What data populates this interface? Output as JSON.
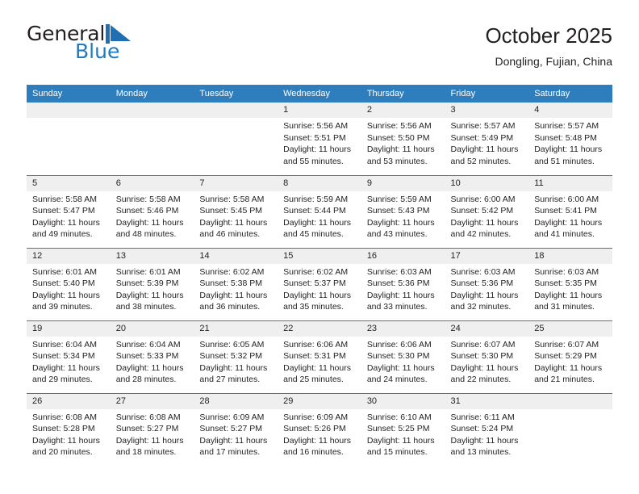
{
  "brand": {
    "name_part1": "General",
    "name_part2": "Blue",
    "mark_icon": "flag-triangle-icon",
    "accent_color": "#1f7bc1"
  },
  "header": {
    "month_title": "October 2025",
    "location": "Dongling, Fujian, China"
  },
  "colors": {
    "header_blue": "#2e7ebd",
    "daynum_band": "#efefef",
    "text": "#231f20"
  },
  "calendar": {
    "weekday_headers": [
      "Sunday",
      "Monday",
      "Tuesday",
      "Wednesday",
      "Thursday",
      "Friday",
      "Saturday"
    ],
    "weeks": [
      [
        {
          "day": "",
          "empty": true,
          "sunrise": "",
          "sunset": "",
          "daylight1": "",
          "daylight2": ""
        },
        {
          "day": "",
          "empty": true,
          "sunrise": "",
          "sunset": "",
          "daylight1": "",
          "daylight2": ""
        },
        {
          "day": "",
          "empty": true,
          "sunrise": "",
          "sunset": "",
          "daylight1": "",
          "daylight2": ""
        },
        {
          "day": "1",
          "empty": false,
          "sunrise": "Sunrise: 5:56 AM",
          "sunset": "Sunset: 5:51 PM",
          "daylight1": "Daylight: 11 hours",
          "daylight2": "and 55 minutes."
        },
        {
          "day": "2",
          "empty": false,
          "sunrise": "Sunrise: 5:56 AM",
          "sunset": "Sunset: 5:50 PM",
          "daylight1": "Daylight: 11 hours",
          "daylight2": "and 53 minutes."
        },
        {
          "day": "3",
          "empty": false,
          "sunrise": "Sunrise: 5:57 AM",
          "sunset": "Sunset: 5:49 PM",
          "daylight1": "Daylight: 11 hours",
          "daylight2": "and 52 minutes."
        },
        {
          "day": "4",
          "empty": false,
          "sunrise": "Sunrise: 5:57 AM",
          "sunset": "Sunset: 5:48 PM",
          "daylight1": "Daylight: 11 hours",
          "daylight2": "and 51 minutes."
        }
      ],
      [
        {
          "day": "5",
          "empty": false,
          "sunrise": "Sunrise: 5:58 AM",
          "sunset": "Sunset: 5:47 PM",
          "daylight1": "Daylight: 11 hours",
          "daylight2": "and 49 minutes."
        },
        {
          "day": "6",
          "empty": false,
          "sunrise": "Sunrise: 5:58 AM",
          "sunset": "Sunset: 5:46 PM",
          "daylight1": "Daylight: 11 hours",
          "daylight2": "and 48 minutes."
        },
        {
          "day": "7",
          "empty": false,
          "sunrise": "Sunrise: 5:58 AM",
          "sunset": "Sunset: 5:45 PM",
          "daylight1": "Daylight: 11 hours",
          "daylight2": "and 46 minutes."
        },
        {
          "day": "8",
          "empty": false,
          "sunrise": "Sunrise: 5:59 AM",
          "sunset": "Sunset: 5:44 PM",
          "daylight1": "Daylight: 11 hours",
          "daylight2": "and 45 minutes."
        },
        {
          "day": "9",
          "empty": false,
          "sunrise": "Sunrise: 5:59 AM",
          "sunset": "Sunset: 5:43 PM",
          "daylight1": "Daylight: 11 hours",
          "daylight2": "and 43 minutes."
        },
        {
          "day": "10",
          "empty": false,
          "sunrise": "Sunrise: 6:00 AM",
          "sunset": "Sunset: 5:42 PM",
          "daylight1": "Daylight: 11 hours",
          "daylight2": "and 42 minutes."
        },
        {
          "day": "11",
          "empty": false,
          "sunrise": "Sunrise: 6:00 AM",
          "sunset": "Sunset: 5:41 PM",
          "daylight1": "Daylight: 11 hours",
          "daylight2": "and 41 minutes."
        }
      ],
      [
        {
          "day": "12",
          "empty": false,
          "sunrise": "Sunrise: 6:01 AM",
          "sunset": "Sunset: 5:40 PM",
          "daylight1": "Daylight: 11 hours",
          "daylight2": "and 39 minutes."
        },
        {
          "day": "13",
          "empty": false,
          "sunrise": "Sunrise: 6:01 AM",
          "sunset": "Sunset: 5:39 PM",
          "daylight1": "Daylight: 11 hours",
          "daylight2": "and 38 minutes."
        },
        {
          "day": "14",
          "empty": false,
          "sunrise": "Sunrise: 6:02 AM",
          "sunset": "Sunset: 5:38 PM",
          "daylight1": "Daylight: 11 hours",
          "daylight2": "and 36 minutes."
        },
        {
          "day": "15",
          "empty": false,
          "sunrise": "Sunrise: 6:02 AM",
          "sunset": "Sunset: 5:37 PM",
          "daylight1": "Daylight: 11 hours",
          "daylight2": "and 35 minutes."
        },
        {
          "day": "16",
          "empty": false,
          "sunrise": "Sunrise: 6:03 AM",
          "sunset": "Sunset: 5:36 PM",
          "daylight1": "Daylight: 11 hours",
          "daylight2": "and 33 minutes."
        },
        {
          "day": "17",
          "empty": false,
          "sunrise": "Sunrise: 6:03 AM",
          "sunset": "Sunset: 5:36 PM",
          "daylight1": "Daylight: 11 hours",
          "daylight2": "and 32 minutes."
        },
        {
          "day": "18",
          "empty": false,
          "sunrise": "Sunrise: 6:03 AM",
          "sunset": "Sunset: 5:35 PM",
          "daylight1": "Daylight: 11 hours",
          "daylight2": "and 31 minutes."
        }
      ],
      [
        {
          "day": "19",
          "empty": false,
          "sunrise": "Sunrise: 6:04 AM",
          "sunset": "Sunset: 5:34 PM",
          "daylight1": "Daylight: 11 hours",
          "daylight2": "and 29 minutes."
        },
        {
          "day": "20",
          "empty": false,
          "sunrise": "Sunrise: 6:04 AM",
          "sunset": "Sunset: 5:33 PM",
          "daylight1": "Daylight: 11 hours",
          "daylight2": "and 28 minutes."
        },
        {
          "day": "21",
          "empty": false,
          "sunrise": "Sunrise: 6:05 AM",
          "sunset": "Sunset: 5:32 PM",
          "daylight1": "Daylight: 11 hours",
          "daylight2": "and 27 minutes."
        },
        {
          "day": "22",
          "empty": false,
          "sunrise": "Sunrise: 6:06 AM",
          "sunset": "Sunset: 5:31 PM",
          "daylight1": "Daylight: 11 hours",
          "daylight2": "and 25 minutes."
        },
        {
          "day": "23",
          "empty": false,
          "sunrise": "Sunrise: 6:06 AM",
          "sunset": "Sunset: 5:30 PM",
          "daylight1": "Daylight: 11 hours",
          "daylight2": "and 24 minutes."
        },
        {
          "day": "24",
          "empty": false,
          "sunrise": "Sunrise: 6:07 AM",
          "sunset": "Sunset: 5:30 PM",
          "daylight1": "Daylight: 11 hours",
          "daylight2": "and 22 minutes."
        },
        {
          "day": "25",
          "empty": false,
          "sunrise": "Sunrise: 6:07 AM",
          "sunset": "Sunset: 5:29 PM",
          "daylight1": "Daylight: 11 hours",
          "daylight2": "and 21 minutes."
        }
      ],
      [
        {
          "day": "26",
          "empty": false,
          "sunrise": "Sunrise: 6:08 AM",
          "sunset": "Sunset: 5:28 PM",
          "daylight1": "Daylight: 11 hours",
          "daylight2": "and 20 minutes."
        },
        {
          "day": "27",
          "empty": false,
          "sunrise": "Sunrise: 6:08 AM",
          "sunset": "Sunset: 5:27 PM",
          "daylight1": "Daylight: 11 hours",
          "daylight2": "and 18 minutes."
        },
        {
          "day": "28",
          "empty": false,
          "sunrise": "Sunrise: 6:09 AM",
          "sunset": "Sunset: 5:27 PM",
          "daylight1": "Daylight: 11 hours",
          "daylight2": "and 17 minutes."
        },
        {
          "day": "29",
          "empty": false,
          "sunrise": "Sunrise: 6:09 AM",
          "sunset": "Sunset: 5:26 PM",
          "daylight1": "Daylight: 11 hours",
          "daylight2": "and 16 minutes."
        },
        {
          "day": "30",
          "empty": false,
          "sunrise": "Sunrise: 6:10 AM",
          "sunset": "Sunset: 5:25 PM",
          "daylight1": "Daylight: 11 hours",
          "daylight2": "and 15 minutes."
        },
        {
          "day": "31",
          "empty": false,
          "sunrise": "Sunrise: 6:11 AM",
          "sunset": "Sunset: 5:24 PM",
          "daylight1": "Daylight: 11 hours",
          "daylight2": "and 13 minutes."
        },
        {
          "day": "",
          "empty": true,
          "sunrise": "",
          "sunset": "",
          "daylight1": "",
          "daylight2": ""
        }
      ]
    ]
  }
}
